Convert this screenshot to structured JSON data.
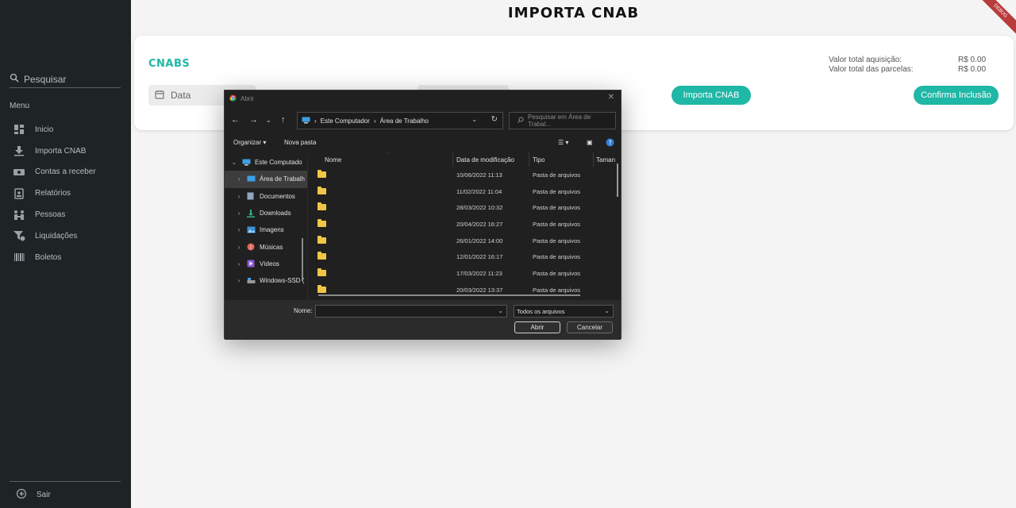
{
  "page": {
    "title": "IMPORTA CNAB",
    "debug_label": "DEBUG"
  },
  "sidebar": {
    "search_placeholder": "Pesquisar",
    "menu_title": "Menu",
    "items": [
      {
        "label": "Inicio",
        "icon": "dashboard-icon"
      },
      {
        "label": "Importa CNAB",
        "icon": "download-icon"
      },
      {
        "label": "Contas a receber",
        "icon": "money-icon"
      },
      {
        "label": "Relatórios",
        "icon": "report-icon"
      },
      {
        "label": "Pessoas",
        "icon": "people-icon"
      },
      {
        "label": "Liquidações",
        "icon": "liquidation-icon"
      },
      {
        "label": "Boletos",
        "icon": "barcode-icon"
      }
    ],
    "logout_label": "Sair"
  },
  "card": {
    "title": "CNABS",
    "totals": [
      {
        "label": "Valor total aquisição:",
        "value": "R$ 0.00"
      },
      {
        "label": "Valor total das parcelas:",
        "value": "R$ 0.00"
      }
    ],
    "date_placeholder": "Data",
    "import_button": "Importa CNAB",
    "confirm_button": "Confirma Inclusão"
  },
  "dialog": {
    "title": "Abrir",
    "breadcrumb": [
      "Este Computador",
      "Área de Trabalho"
    ],
    "search_placeholder": "Pesquisar em Área de Trabal...",
    "toolbar": {
      "organize": "Organizar",
      "new_folder": "Nova pasta"
    },
    "tree": [
      {
        "label": "Este Computado",
        "icon": "computer-icon",
        "expanded": true
      },
      {
        "label": "Área de Trabalh",
        "icon": "desktop-icon",
        "selected": true
      },
      {
        "label": "Documentos",
        "icon": "documents-icon"
      },
      {
        "label": "Downloads",
        "icon": "downloads-icon"
      },
      {
        "label": "Imagens",
        "icon": "images-icon"
      },
      {
        "label": "Músicas",
        "icon": "music-icon"
      },
      {
        "label": "Vídeos",
        "icon": "videos-icon"
      },
      {
        "label": "Windows-SSD (",
        "icon": "drive-icon"
      }
    ],
    "columns": {
      "name": "Nome",
      "modified": "Data de modificação",
      "type": "Tipo",
      "size": "Taman"
    },
    "files": [
      {
        "name": "",
        "modified": "10/06/2022 11:13",
        "type": "Pasta de arquivos"
      },
      {
        "name": "",
        "modified": "11/02/2022 11:04",
        "type": "Pasta de arquivos"
      },
      {
        "name": "",
        "modified": "28/03/2022 10:32",
        "type": "Pasta de arquivos"
      },
      {
        "name": "",
        "modified": "20/04/2022 16:27",
        "type": "Pasta de arquivos"
      },
      {
        "name": "",
        "modified": "26/01/2022 14:00",
        "type": "Pasta de arquivos"
      },
      {
        "name": "",
        "modified": "12/01/2022 16:17",
        "type": "Pasta de arquivos"
      },
      {
        "name": "",
        "modified": "17/03/2022 11:23",
        "type": "Pasta de arquivos"
      },
      {
        "name": "",
        "modified": "20/03/2022 13:37",
        "type": "Pasta de arquivos"
      }
    ],
    "name_label": "Nome:",
    "name_value": "",
    "filter_value": "Todos os arquivos",
    "open_button": "Abrir",
    "cancel_button": "Cancelar"
  },
  "colors": {
    "accent": "#1fb7a6",
    "sidebar_bg": "#1e2326",
    "dialog_bg": "#202020",
    "folder": "#f1c646"
  }
}
